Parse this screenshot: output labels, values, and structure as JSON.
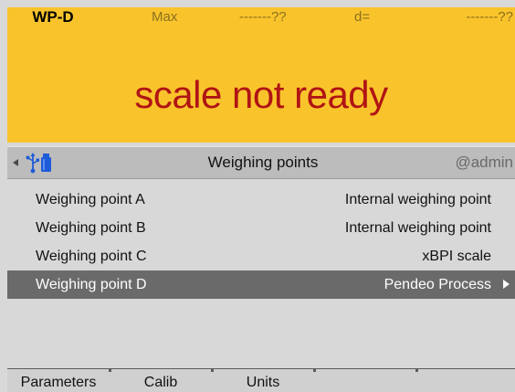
{
  "status": {
    "weighing_point": "WP-D",
    "max_label": "Max",
    "max_value": "-------??",
    "d_label": "d=",
    "d_value": "-------??",
    "message": "scale not ready"
  },
  "titlebar": {
    "back_icon": "triangle-left-icon",
    "connection_icon": "usb-icon",
    "title": "Weighing points",
    "user": "@admin"
  },
  "list": {
    "items": [
      {
        "name": "Weighing point A",
        "value": "Internal weighing point",
        "selected": false
      },
      {
        "name": "Weighing point B",
        "value": "Internal weighing point",
        "selected": false
      },
      {
        "name": "Weighing point C",
        "value": "xBPI scale",
        "selected": false
      },
      {
        "name": "Weighing point D",
        "value": "Pendeo Process",
        "selected": true
      }
    ]
  },
  "softkeys": {
    "labels": [
      "Parameters",
      "Calib",
      "Units",
      "",
      ""
    ]
  },
  "colors": {
    "status_bg": "#f9c42b",
    "status_text": "#b01414",
    "selection_bg": "#6a6a6a",
    "usb_blue": "#1e5bd8"
  }
}
